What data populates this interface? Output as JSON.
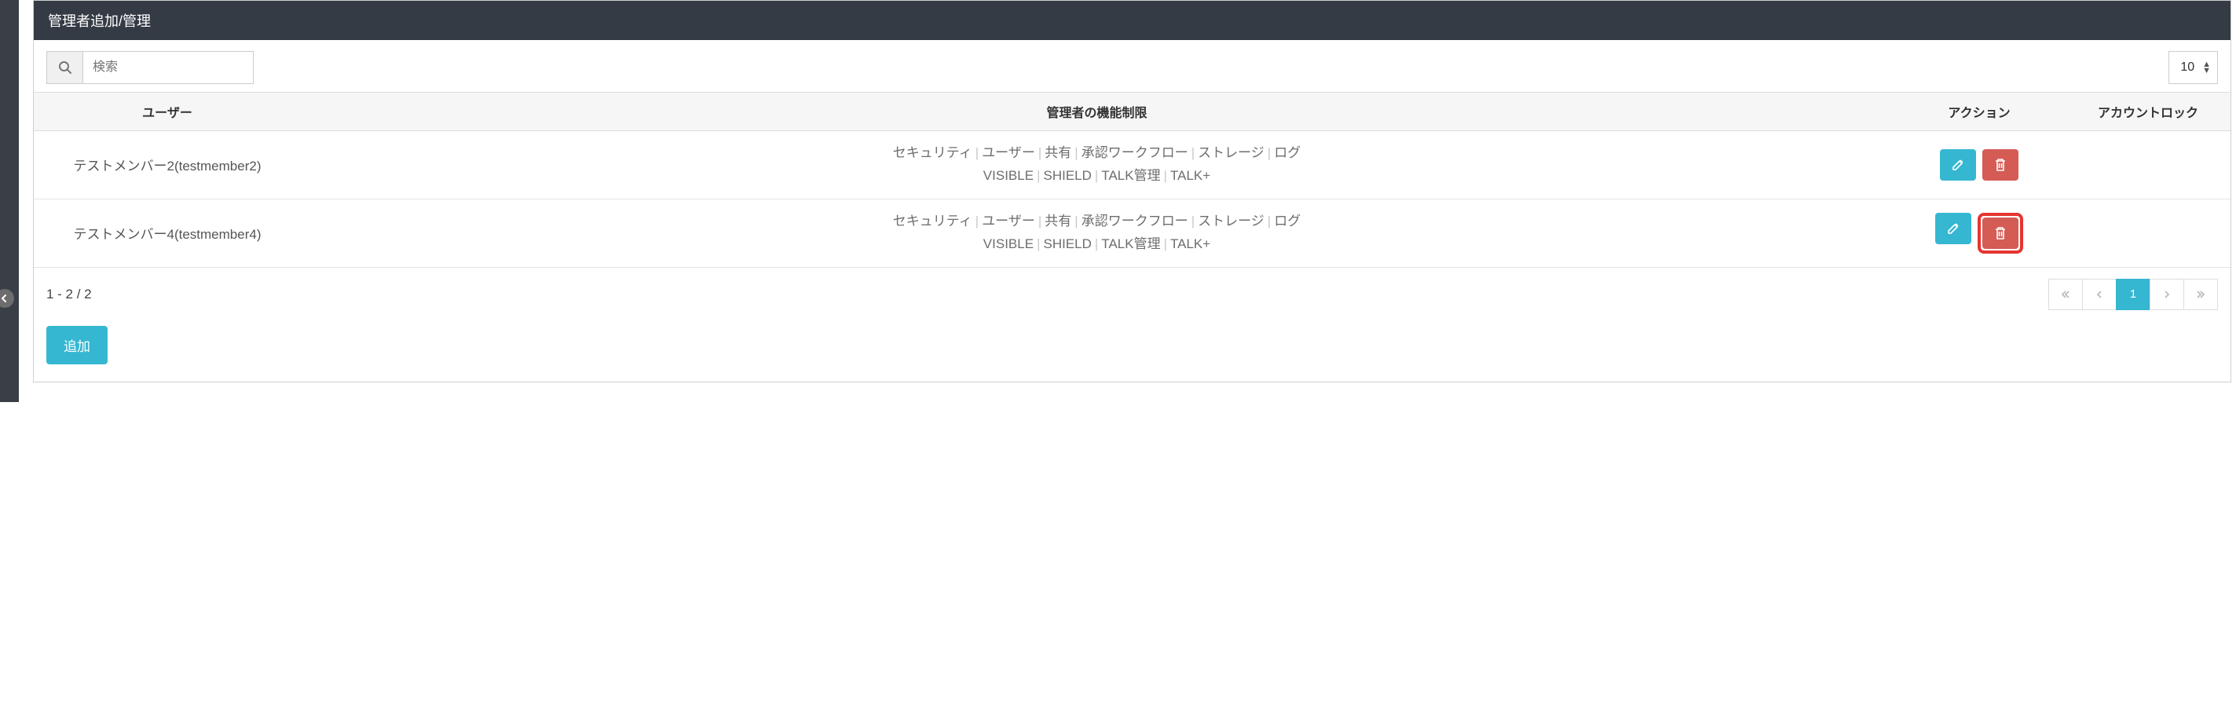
{
  "header": {
    "title": "管理者追加/管理"
  },
  "toolbar": {
    "search_placeholder": "検索",
    "page_size": "10"
  },
  "columns": {
    "user": "ユーザー",
    "permissions": "管理者の機能制限",
    "action": "アクション",
    "lock": "アカウントロック"
  },
  "permissions_tokens": [
    "セキュリティ",
    "ユーザー",
    "共有",
    "承認ワークフロー",
    "ストレージ",
    "ログ",
    "VISIBLE",
    "SHIELD",
    "TALK管理",
    "TALK+"
  ],
  "rows": [
    {
      "user": "テストメンバー2(testmember2)",
      "highlight_delete": false
    },
    {
      "user": "テストメンバー4(testmember4)",
      "highlight_delete": true
    }
  ],
  "footer": {
    "range": "1 - 2 / 2",
    "current_page": "1",
    "add_label": "追加"
  }
}
